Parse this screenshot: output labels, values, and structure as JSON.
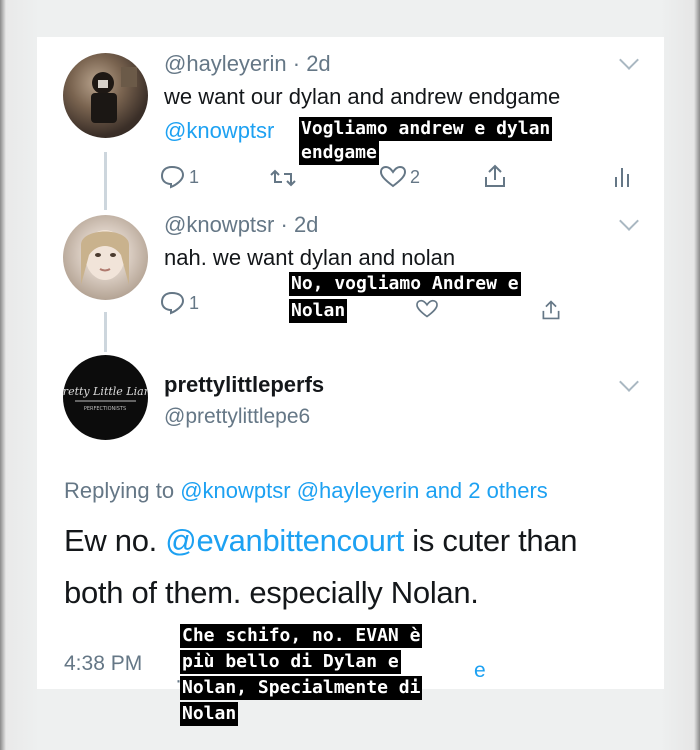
{
  "tweets": [
    {
      "handle": "@hayleyerin",
      "time": "2d",
      "text": "we want our dylan and andrew endgame",
      "mention": "@knowptsr",
      "caption_lines": [
        "Vogliamo andrew e dylan",
        "endgame"
      ],
      "replies": "1",
      "likes": "2"
    },
    {
      "handle": "@knowptsr",
      "time": "2d",
      "text": "nah. we want dylan and nolan",
      "caption_lines": [
        "No, vogliamo Andrew e",
        "Nolan"
      ],
      "replies": "1"
    },
    {
      "display_name": "prettylittleperfs",
      "handle": "@prettylittlepe6",
      "replying_prefix": "Replying to",
      "reply_mentions": [
        "@knowptsr",
        "@hayleyerin"
      ],
      "reply_others": "and 2 others",
      "text_line1_a": "Ew no. ",
      "text_line1_mention": "@evanbittencourt",
      "text_line1_b": " is cuter than",
      "text_line2": "both of them. especially Nolan.",
      "timestamp": "4:38 PM",
      "overlap_letter": "e",
      "caption_lines": [
        "Che schifo, no. EVAN è",
        "più bello di Dylan e",
        "Nolan, Specialmente di",
        "Nolan"
      ]
    }
  ],
  "colors": {
    "link": "#1da1f2",
    "muted": "#657786",
    "text": "#14171a",
    "caption_bg": "#000000"
  }
}
